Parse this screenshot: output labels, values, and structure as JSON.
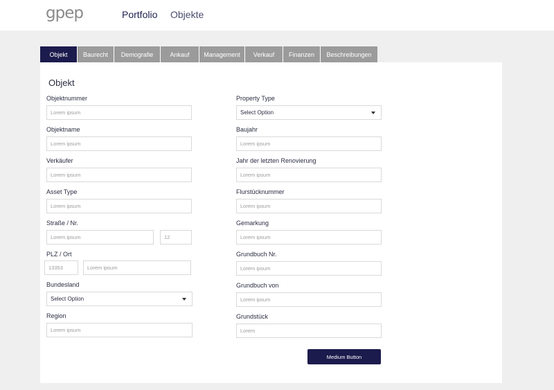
{
  "header": {
    "logo": "gpep",
    "nav": {
      "portfolio": "Portfolio",
      "objekte": "Objekte"
    }
  },
  "tabs": [
    {
      "label": "Objekt",
      "active": true
    },
    {
      "label": "Baurecht",
      "active": false
    },
    {
      "label": "Demografie",
      "active": false
    },
    {
      "label": "Ankauf",
      "active": false
    },
    {
      "label": "Management",
      "active": false
    },
    {
      "label": "Verkauf",
      "active": false
    },
    {
      "label": "Finanzen",
      "active": false
    },
    {
      "label": "Beschreibungen",
      "active": false
    }
  ],
  "form": {
    "title": "Objekt",
    "left": {
      "objektnummer": {
        "label": "Objektnummer",
        "value": "Lorem ipsum"
      },
      "objektname": {
        "label": "Objektname",
        "value": "Lorem ipsum"
      },
      "verkaeufer": {
        "label": "Verkäufer",
        "value": "Lorem ipsum"
      },
      "asset_type": {
        "label": "Asset Type",
        "value": "Lorem ipsum"
      },
      "strasse": {
        "label": "Straße / Nr.",
        "street": "Lorem ipsum",
        "number": "12"
      },
      "plz_ort": {
        "label": "PLZ / Ort",
        "plz": "13353",
        "ort": "Lorem ipsum"
      },
      "bundesland": {
        "label": "Bundesland",
        "value": "Select Option"
      },
      "region": {
        "label": "Region",
        "value": "Lorem ipsum"
      }
    },
    "right": {
      "property_type": {
        "label": "Property Type",
        "value": "Select Option"
      },
      "baujahr": {
        "label": "Baujahr",
        "value": "Lorem ipsum"
      },
      "renovierung": {
        "label": "Jahr der letzten Renovierung",
        "value": "Lorem ipsum"
      },
      "flurstueck": {
        "label": "Flurstücknummer",
        "value": "Lorem ipsum"
      },
      "gemarkung": {
        "label": "Gemarkung",
        "value": "Lorem ipsum"
      },
      "grundbuch_nr": {
        "label": "Grundbuch Nr.",
        "value": "Lorem ipsum"
      },
      "grundbuch_von": {
        "label": "Grundbuch von",
        "value": "Lorem ipsum"
      },
      "grundstueck": {
        "label": "Grundstück",
        "value": "Lorem"
      }
    },
    "button": "Medium Button"
  },
  "colors": {
    "primary": "#1c1b4d",
    "tab_inactive": "#9b9b9b",
    "page_bg": "#efefef",
    "card_bg": "#ffffff"
  }
}
